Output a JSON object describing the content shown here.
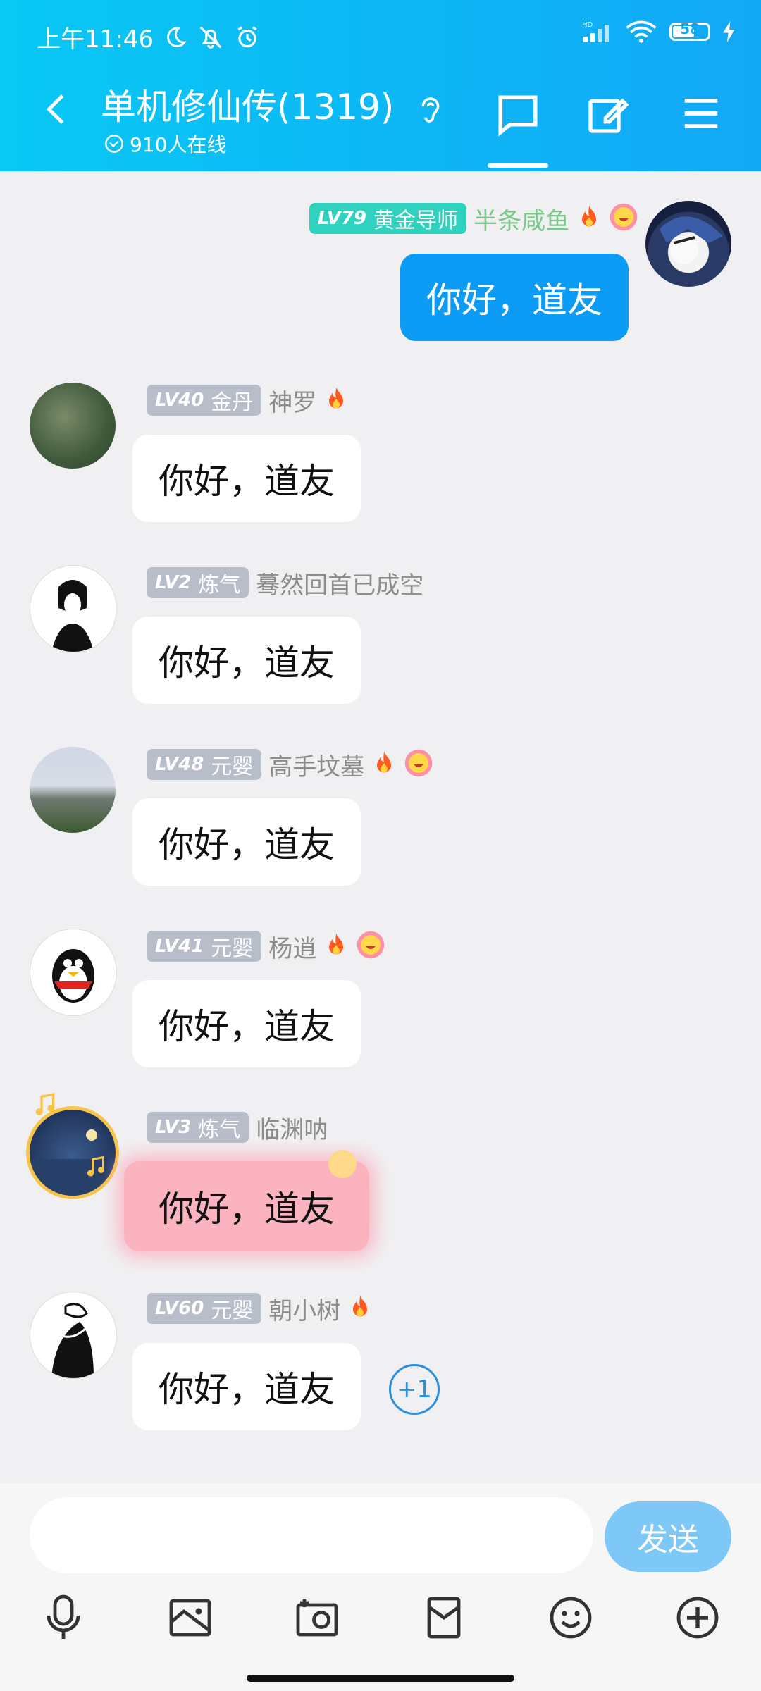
{
  "status": {
    "time": "上午11:46",
    "battery": "58",
    "network": "HD"
  },
  "header": {
    "title": "单机修仙传(1319)",
    "online": "910人在线"
  },
  "messages": [
    {
      "side": "right",
      "lv": "LV79",
      "rank": "黄金导师",
      "nick": "半条咸鱼",
      "text": "你好，道友",
      "emojis": [
        "fire",
        "grin"
      ]
    },
    {
      "side": "left",
      "lv": "LV40",
      "rank": "金丹",
      "nick": "神罗",
      "text": "你好，道友",
      "emojis": [
        "fire"
      ]
    },
    {
      "side": "left",
      "lv": "LV2",
      "rank": "炼气",
      "nick": "蓦然回首已成空",
      "text": "你好，道友",
      "emojis": []
    },
    {
      "side": "left",
      "lv": "LV48",
      "rank": "元婴",
      "nick": "高手坟墓",
      "text": "你好，道友",
      "emojis": [
        "fire",
        "grin"
      ]
    },
    {
      "side": "left",
      "lv": "LV41",
      "rank": "元婴",
      "nick": "杨逍",
      "text": "你好，道友",
      "emojis": [
        "fire",
        "grin"
      ]
    },
    {
      "side": "left",
      "lv": "LV3",
      "rank": "炼气",
      "nick": "临渊呐",
      "text": "你好，道友",
      "emojis": []
    },
    {
      "side": "left",
      "lv": "LV60",
      "rank": "元婴",
      "nick": "朝小树",
      "text": "你好，道友",
      "emojis": [
        "fire"
      ]
    }
  ],
  "plus_one": "+1",
  "input": {
    "placeholder": "",
    "send_label": "发送"
  },
  "toolbar": [
    "microphone-icon",
    "image-icon",
    "camera-icon",
    "red-packet-icon",
    "emoji-icon",
    "plus-icon"
  ],
  "colors": {
    "header_start": "#08c8f4",
    "header_end": "#12a8f6",
    "bubble_me": "#0d9cf5",
    "nick_gold": "#7bc98a",
    "lv_gold": "#2fd1bf"
  }
}
